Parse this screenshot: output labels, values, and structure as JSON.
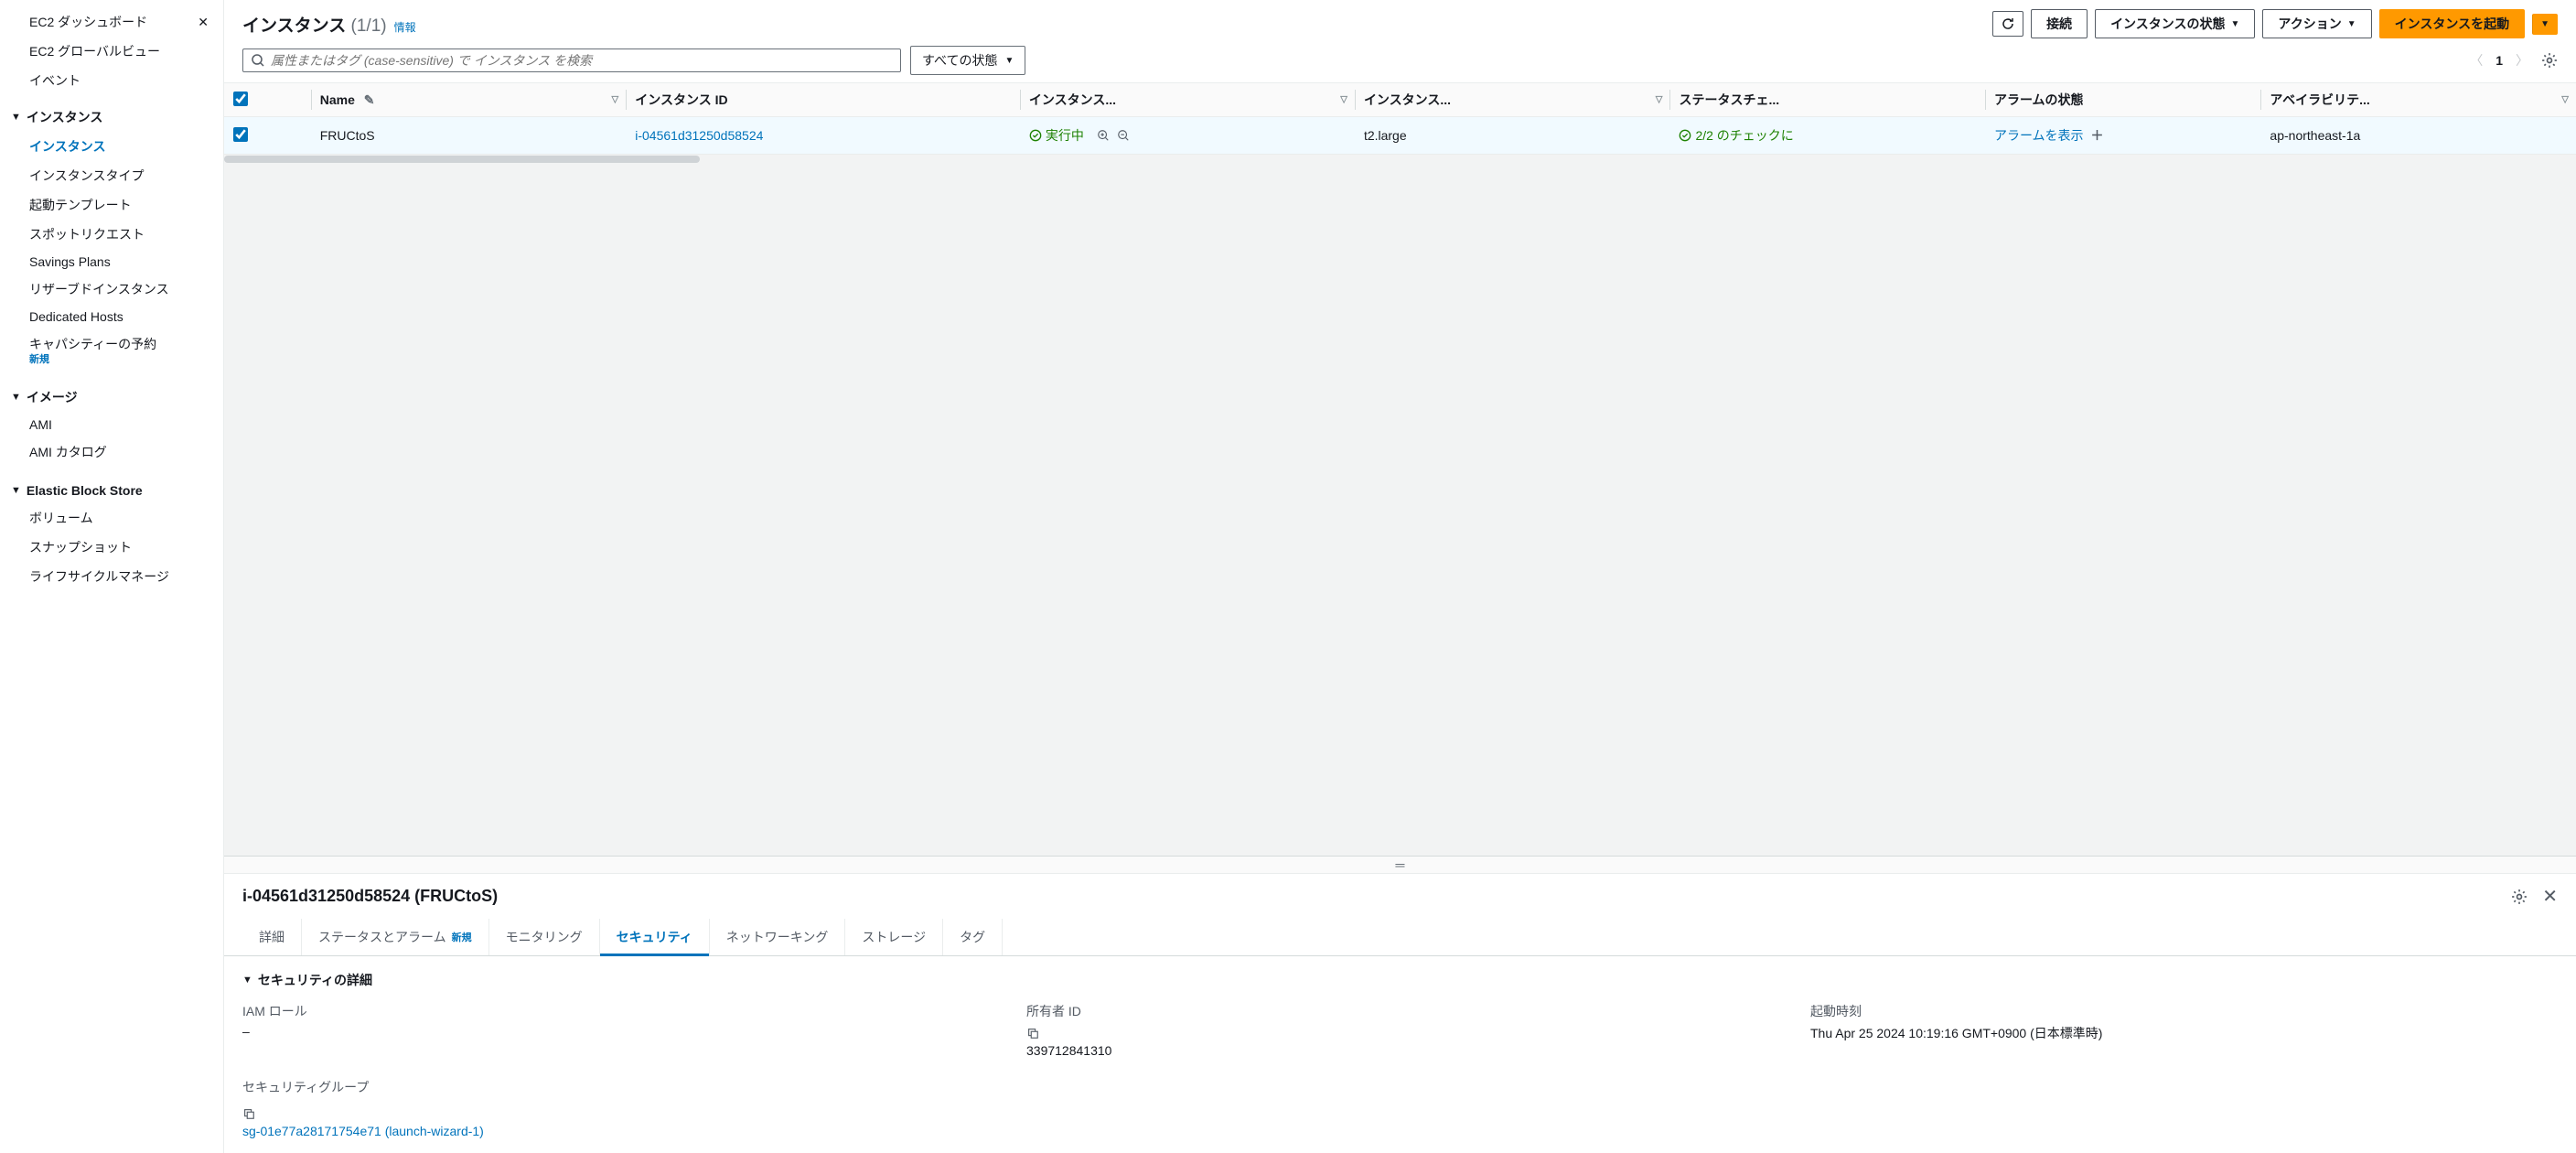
{
  "sidebar": {
    "top_items": [
      "EC2 ダッシュボード",
      "EC2 グローバルビュー",
      "イベント"
    ],
    "sections": [
      {
        "title": "インスタンス",
        "items": [
          {
            "label": "インスタンス",
            "active": true
          },
          {
            "label": "インスタンスタイプ"
          },
          {
            "label": "起動テンプレート"
          },
          {
            "label": "スポットリクエスト"
          },
          {
            "label": "Savings Plans"
          },
          {
            "label": "リザーブドインスタンス"
          },
          {
            "label": "Dedicated Hosts"
          },
          {
            "label": "キャパシティーの予約",
            "badge": "新規"
          }
        ]
      },
      {
        "title": "イメージ",
        "items": [
          {
            "label": "AMI"
          },
          {
            "label": "AMI カタログ"
          }
        ]
      },
      {
        "title": "Elastic Block Store",
        "items": [
          {
            "label": "ボリューム"
          },
          {
            "label": "スナップショット"
          },
          {
            "label": "ライフサイクルマネージ"
          }
        ]
      }
    ]
  },
  "header": {
    "title": "インスタンス",
    "count": "(1/1)",
    "info": "情報",
    "buttons": {
      "connect": "接続",
      "instance_state": "インスタンスの状態",
      "actions": "アクション",
      "launch": "インスタンスを起動"
    }
  },
  "filter": {
    "search_placeholder": "属性またはタグ (case-sensitive) で インスタンス を検索",
    "state_filter": "すべての状態",
    "page": "1"
  },
  "table": {
    "columns": [
      "Name",
      "インスタンス ID",
      "インスタンス...",
      "インスタンス...",
      "ステータスチェ...",
      "アラームの状態",
      "アベイラビリテ..."
    ],
    "row": {
      "name": "FRUCtoS",
      "instance_id": "i-04561d31250d58524",
      "state": "実行中",
      "type": "t2.large",
      "status_check": "2/2 のチェックに",
      "alarm": "アラームを表示",
      "az": "ap-northeast-1a"
    }
  },
  "details": {
    "title": "i-04561d31250d58524 (FRUCtoS)",
    "tabs": [
      {
        "label": "詳細"
      },
      {
        "label": "ステータスとアラーム",
        "badge": "新規"
      },
      {
        "label": "モニタリング"
      },
      {
        "label": "セキュリティ",
        "active": true
      },
      {
        "label": "ネットワーキング"
      },
      {
        "label": "ストレージ"
      },
      {
        "label": "タグ"
      }
    ],
    "section_title": "セキュリティの詳細",
    "fields": {
      "iam_role": {
        "label": "IAM ロール",
        "value": "–"
      },
      "owner_id": {
        "label": "所有者 ID",
        "value": "339712841310"
      },
      "launch_time": {
        "label": "起動時刻",
        "value": "Thu Apr 25 2024 10:19:16 GMT+0900 (日本標準時)"
      },
      "security_groups": {
        "label": "セキュリティグループ",
        "value": "sg-01e77a28171754e71 (launch-wizard-1)"
      }
    }
  }
}
